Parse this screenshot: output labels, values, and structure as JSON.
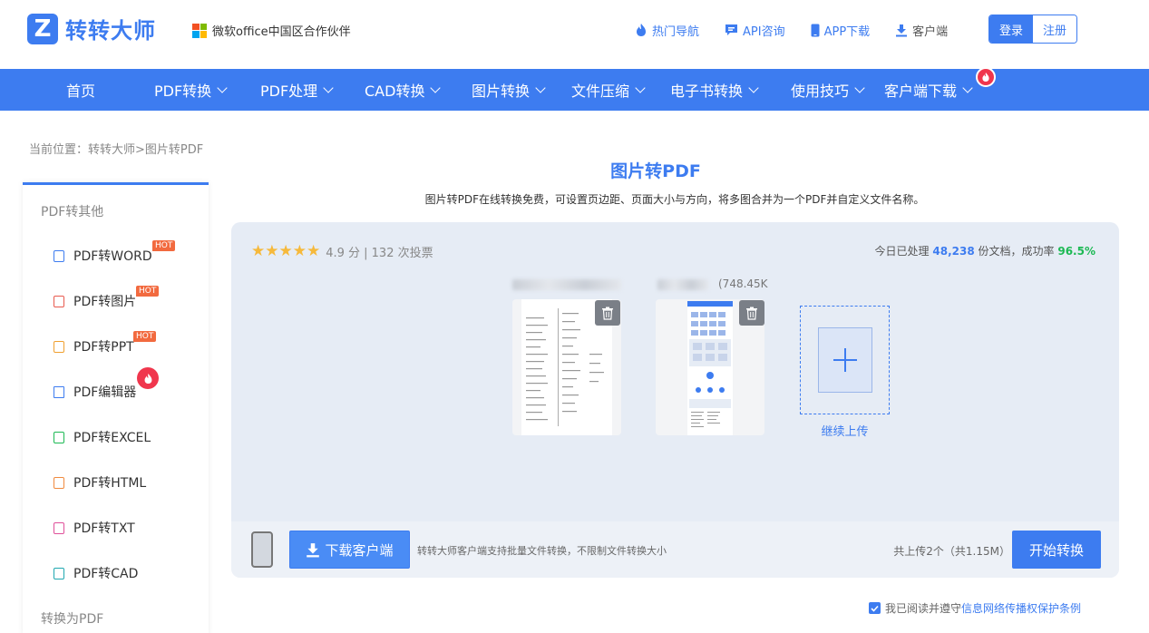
{
  "header": {
    "logo_mark": "Z",
    "logo_text": "转转大师",
    "partner_text": "微软office中国区合作伙伴",
    "links": [
      {
        "label": "热门导航",
        "icon": "flame-icon"
      },
      {
        "label": "API咨询",
        "icon": "chat-icon"
      },
      {
        "label": "APP下载",
        "icon": "phone-icon"
      },
      {
        "label": "客户端",
        "icon": "download-icon"
      }
    ],
    "login": "登录",
    "register": "注册"
  },
  "nav": {
    "items": [
      {
        "label": "首页"
      },
      {
        "label": "PDF转换"
      },
      {
        "label": "PDF处理"
      },
      {
        "label": "CAD转换"
      },
      {
        "label": "图片转换"
      },
      {
        "label": "文件压缩"
      },
      {
        "label": "电子书转换"
      },
      {
        "label": "使用技巧"
      },
      {
        "label": "客户端下载"
      }
    ]
  },
  "breadcrumb": "当前位置：转转大师>图片转PDF",
  "sidebar": {
    "heading_from": "PDF转其他",
    "heading_to": "转换为PDF",
    "hot_label": "HOT",
    "items": [
      {
        "label": "PDF转WORD",
        "color": "#3d7cf0"
      },
      {
        "label": "PDF转图片",
        "color": "#e85a4f"
      },
      {
        "label": "PDF转PPT",
        "color": "#f0a030"
      },
      {
        "label": "PDF编辑器",
        "color": "#3d7cf0"
      },
      {
        "label": "PDF转EXCEL",
        "color": "#1db954"
      },
      {
        "label": "PDF转HTML",
        "color": "#f08a3e"
      },
      {
        "label": "PDF转TXT",
        "color": "#e0509a"
      },
      {
        "label": "PDF转CAD",
        "color": "#20a8b0"
      }
    ]
  },
  "main": {
    "title": "图片转PDF",
    "description": "图片转PDF在线转换免费，可设置页边距、页面大小与方向，将多图合并为一个PDF并自定义文件名称。",
    "rating_stars": "★★★★★",
    "rating_text": "4.9 分 | 132 次投票",
    "stats_prefix": "今日已处理",
    "stats_count": "48,238",
    "stats_middle": "份文档，成功率",
    "stats_rate": "96.5%",
    "file2_size": "(748.45K",
    "upload_more": "继续上传",
    "download_client": "下载客户端",
    "client_tip": "转转大师客户端支持批量文件转换，不限制文件转换大小",
    "upload_count": "共上传2个（共1.15M）",
    "start_convert": "开始转换",
    "agree_prefix": "我已阅读并遵守",
    "agree_link": "信息网络传播权保护条例"
  },
  "colors": {
    "accent": "#3d7cf0",
    "success": "#1db954",
    "hot": "#f26a3f",
    "fire": "#f0364d",
    "star": "#f6b93b"
  }
}
